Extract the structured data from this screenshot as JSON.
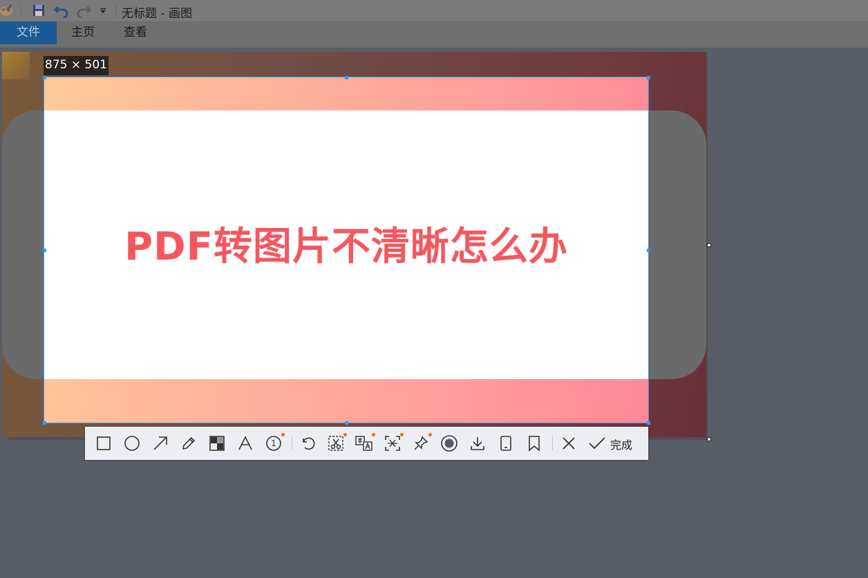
{
  "window": {
    "title": "无标题 - 画图"
  },
  "ribbon": {
    "tabs": [
      {
        "label": "文件"
      },
      {
        "label": "主页"
      },
      {
        "label": "查看"
      }
    ]
  },
  "selection": {
    "size_label": "875 × 501"
  },
  "image": {
    "headline": "PDF转图片不清晰怎么办"
  },
  "toolbar": {
    "tools": [
      {
        "icon": "rectangle-icon"
      },
      {
        "icon": "circle-icon"
      },
      {
        "icon": "arrow-icon"
      },
      {
        "icon": "pencil-icon"
      },
      {
        "icon": "mosaic-icon"
      },
      {
        "icon": "text-icon"
      },
      {
        "icon": "number-marker-icon",
        "number": "1"
      },
      {
        "icon": "undo-icon"
      },
      {
        "icon": "cut-icon"
      },
      {
        "icon": "translate-icon"
      },
      {
        "icon": "ocr-icon"
      },
      {
        "icon": "pin-icon"
      },
      {
        "icon": "record-icon"
      },
      {
        "icon": "download-icon"
      },
      {
        "icon": "phone-icon"
      },
      {
        "icon": "bookmark-icon"
      },
      {
        "icon": "close-icon"
      },
      {
        "icon": "check-icon"
      }
    ],
    "done_label": "完成"
  },
  "colors": {
    "accent": "#2f9cf0",
    "headline": "#f4575e",
    "file_tab": "#1b5a93",
    "badge_dot": "#f06a1e"
  }
}
